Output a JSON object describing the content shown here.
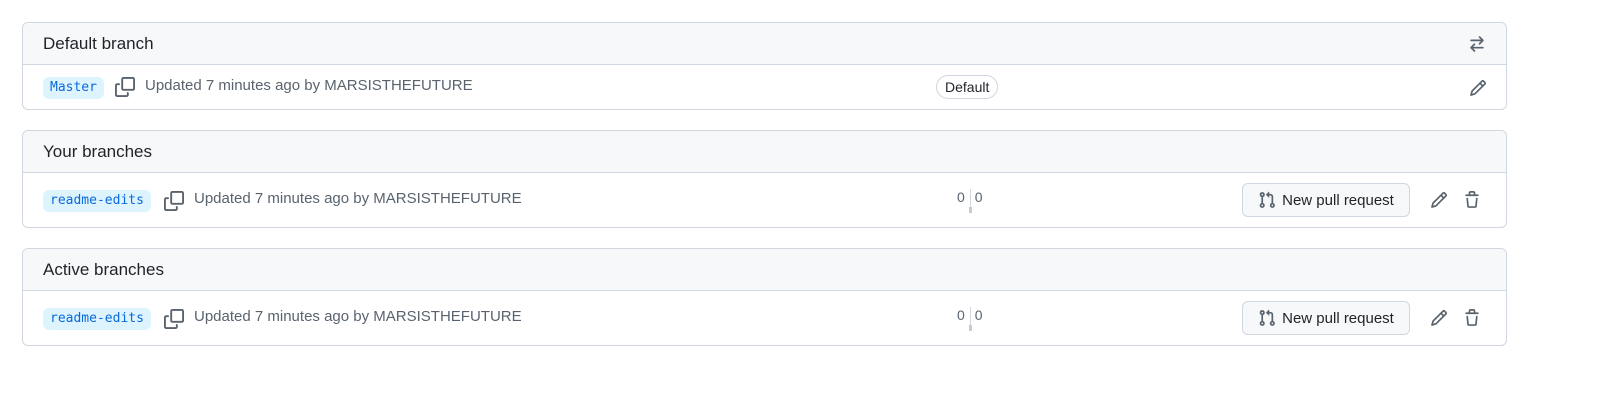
{
  "sections": [
    {
      "title": "Default branch",
      "header_icon": "arrow-switch-icon",
      "rows": [
        {
          "branch": "Master",
          "meta": "Updated 7 minutes ago by MARSISTHEFUTURE",
          "badge": "Default"
        }
      ]
    },
    {
      "title": "Your branches",
      "rows": [
        {
          "branch": "readme-edits",
          "meta": "Updated 7 minutes ago by MARSISTHEFUTURE",
          "behind": "0",
          "ahead": "0",
          "pr_label": "New pull request"
        }
      ]
    },
    {
      "title": "Active branches",
      "rows": [
        {
          "branch": "readme-edits",
          "meta": "Updated 7 minutes ago by MARSISTHEFUTURE",
          "behind": "0",
          "ahead": "0",
          "pr_label": "New pull request"
        }
      ]
    }
  ],
  "colors": {
    "branch_text": "#0969da",
    "branch_bg": "#ddf4ff",
    "border": "#d0d7de",
    "header_bg": "#f6f8fa",
    "muted_text": "#59636e"
  }
}
